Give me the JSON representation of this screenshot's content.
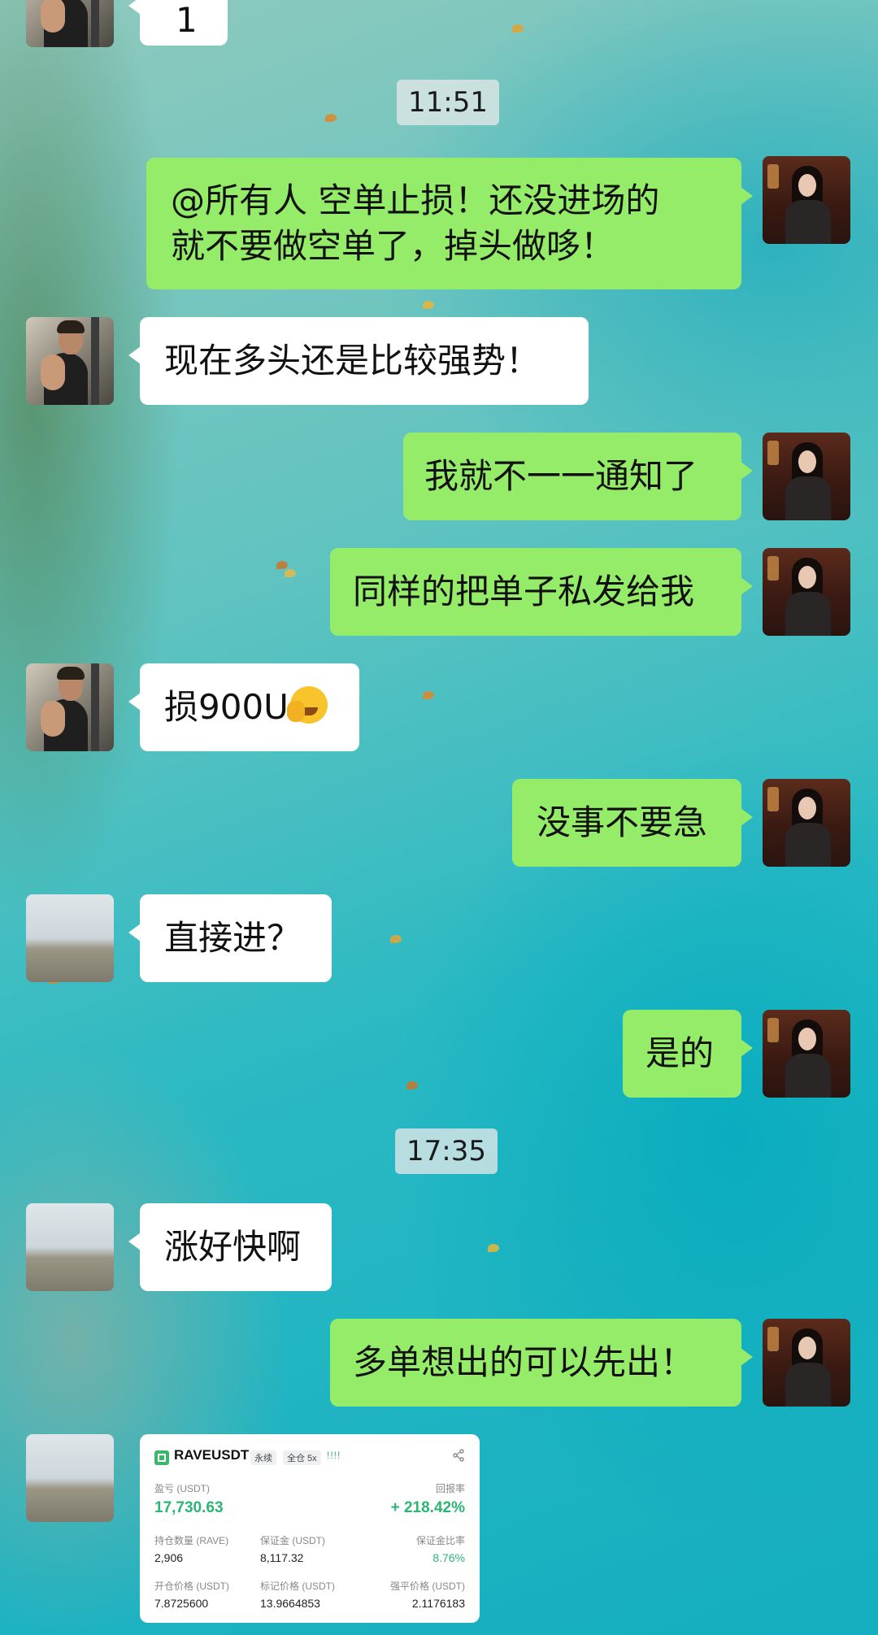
{
  "timestamps": [
    "11:51",
    "17:35"
  ],
  "top_partial": {
    "text": "1"
  },
  "messages": [
    {
      "side": "me",
      "lines": [
        "@所有人 空单止损！还没进场的",
        "就不要做空单了，掉头做哆！"
      ]
    },
    {
      "side": "other",
      "text": "现在多头还是比较强势！"
    },
    {
      "side": "me",
      "text": "我就不一一通知了"
    },
    {
      "side": "me",
      "text": "同样的把单子私发给我"
    },
    {
      "side": "other",
      "text": "损900U",
      "emoji": "face-with-hand-over-mouth-icon"
    },
    {
      "side": "me",
      "text": "没事不要急"
    },
    {
      "side": "other",
      "text": "直接进？"
    },
    {
      "side": "me",
      "text": "是的"
    },
    {
      "side": "other",
      "text": "涨好快啊"
    },
    {
      "side": "me",
      "text": "多单想出的可以先出！"
    }
  ],
  "trade_card": {
    "symbol": "RAVEUSDT",
    "tag_perpetual": "永续",
    "tag_margin": "全仓 5x",
    "bars": "!!!!",
    "pnl_label": "盈亏 (USDT)",
    "pnl_value": "17,730.63",
    "roi_label": "回报率",
    "roi_value": "+ 218.42%",
    "qty_label": "持仓数量 (RAVE)",
    "qty_value": "2,906",
    "margin_label": "保证金 (USDT)",
    "margin_value": "8,117.32",
    "margin_ratio_label": "保证金比率",
    "margin_ratio_value": "8.76%",
    "open_label": "开仓价格 (USDT)",
    "open_value": "7.8725600",
    "mark_label": "标记价格 (USDT)",
    "mark_value": "13.9664853",
    "liq_label": "强平价格 (USDT)",
    "liq_value": "2.1176183"
  },
  "colors": {
    "my_bubble": "#95ec69",
    "other_bubble": "#ffffff",
    "profit_green": "#2bb673"
  }
}
